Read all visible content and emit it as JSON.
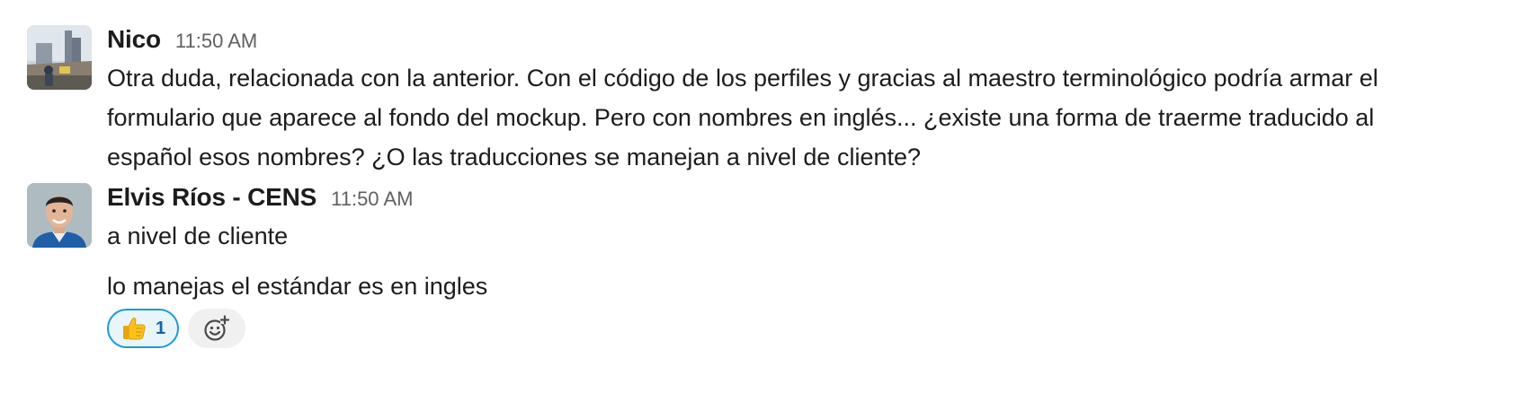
{
  "messages": [
    {
      "sender": "Nico",
      "time": "11:50 AM",
      "avatar_icon": "person-photo-icon",
      "lines": [
        "Otra duda, relacionada con la anterior. Con el código de los perfiles y gracias al maestro terminológico podría armar el",
        "formulario que aparece al fondo del mockup. Pero con nombres en inglés... ¿existe una forma de traerme traducido al",
        "español esos nombres? ¿O las traducciones se manejan a nivel de cliente?"
      ]
    },
    {
      "sender": "Elvis Ríos - CENS",
      "time": "11:50 AM",
      "avatar_icon": "person-photo-icon",
      "texts": [
        "a nivel de cliente",
        "lo manejas el estándar es en ingles"
      ],
      "reactions": [
        {
          "emoji": "thumbs-up-icon",
          "count": "1"
        }
      ],
      "add_reaction_icon": "add-emoji-icon"
    }
  ],
  "colors": {
    "text": "#1d1c1d",
    "timestamp": "#616061",
    "reaction_border": "#1d9bd1",
    "reaction_bg": "#e8f5fa",
    "reaction_count": "#1264a3",
    "add_reaction_bg": "#f0f0f0"
  }
}
